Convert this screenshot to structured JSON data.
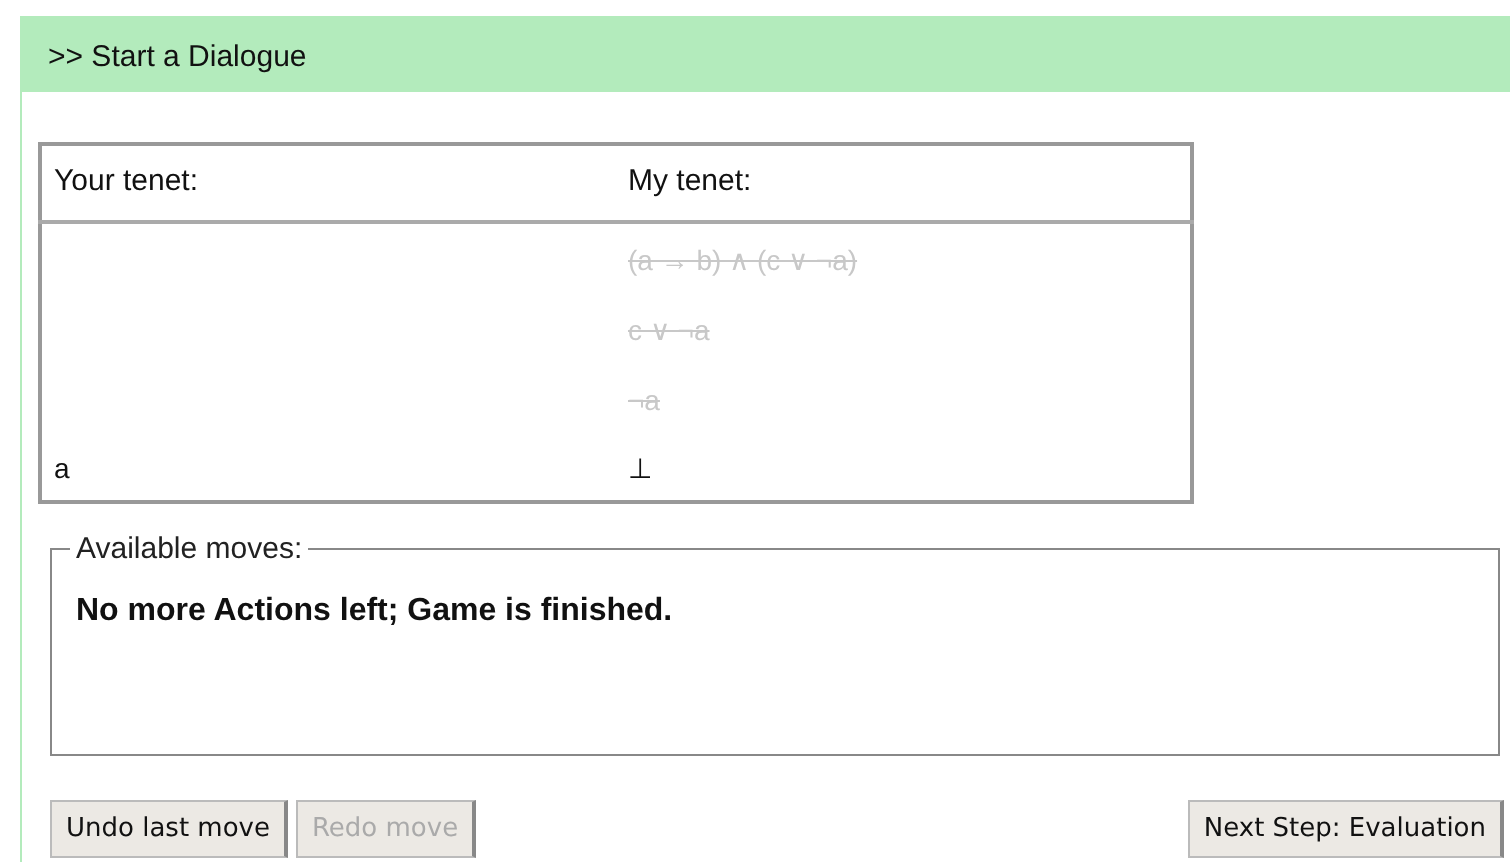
{
  "header": {
    "title": ">> Start a Dialogue"
  },
  "table": {
    "columns": [
      "Your tenet:",
      "My tenet:"
    ],
    "rows": [
      {
        "cells": [
          "",
          "(a → b) ∧ (c ∨ ¬a)"
        ],
        "struck": true
      },
      {
        "cells": [
          "",
          "c ∨ ¬a"
        ],
        "struck": true
      },
      {
        "cells": [
          "",
          "¬a"
        ],
        "struck": true
      },
      {
        "cells": [
          "a",
          "⊥"
        ],
        "struck": false
      }
    ]
  },
  "moves": {
    "legend": "Available moves:",
    "message": "No more Actions left; Game is finished."
  },
  "left_buttons": [
    {
      "label": "Undo last move",
      "disabled": false
    },
    {
      "label": "Redo move",
      "disabled": true
    }
  ],
  "right_buttons": [
    {
      "label": "Next Step: Evaluation",
      "disabled": false
    }
  ]
}
